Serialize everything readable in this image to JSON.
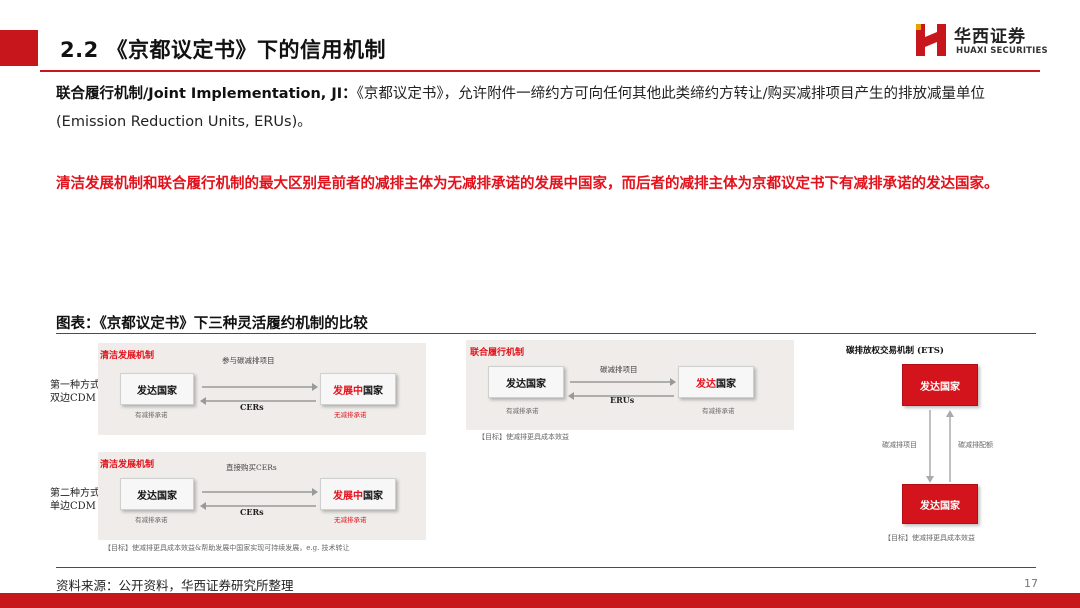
{
  "header": {
    "title": "2.2 《京都议定书》下的信用机制",
    "logo_cn": "华西证券",
    "logo_en": "HUAXI SECURITIES"
  },
  "body": {
    "para1_term": "联合履行机制/Joint Implementation, JI：",
    "para1_text": "《京都议定书》，允许附件一缔约方可向任何其他此类缔约方转让/购买减排项目产生的排放减量单位 (Emission Reduction Units, ERUs)。",
    "para2": "清洁发展机制和联合履行机制的最大区别是前者的减排主体为无减排承诺的发展中国家，而后者的减排主体为京都议定书下有减排承诺的发达国家。"
  },
  "figure": {
    "title": "图表：《京都议定书》下三种灵活履约机制的比较",
    "cdm1": {
      "side_label_1": "第一种方式：",
      "side_label_2": "双边CDM",
      "panel_title": "清洁发展机制",
      "top_arrow_label": "参与碳减排项目",
      "left_box": "发达国家",
      "left_sub": "有减排承诺",
      "right_box_a": "发展",
      "right_box_b": "中",
      "right_box_c": "国家",
      "right_sub": "无减排承诺",
      "bottom_arrow_label": "CERs"
    },
    "cdm2": {
      "side_label_1": "第二种方式：",
      "side_label_2": "单边CDM",
      "panel_title": "清洁发展机制",
      "top_arrow_label": "直接购买CERs",
      "left_box": "发达国家",
      "left_sub": "有减排承诺",
      "right_box_a": "发展",
      "right_box_b": "中",
      "right_box_c": "国家",
      "right_sub": "无减排承诺",
      "bottom_arrow_label": "CERs",
      "goal": "【目标】使减排更具成本效益&帮助发展中国家实现可持续发展，e.g. 技术转让"
    },
    "ji": {
      "panel_title": "联合履行机制",
      "top_arrow_label": "碳减排项目",
      "left_box": "发达国家",
      "left_sub": "有减排承诺",
      "right_box": "发达国家",
      "right_box_a": "发达",
      "right_box_b": "国家",
      "right_sub": "有减排承诺",
      "bottom_arrow_label": "ERUs",
      "goal": "【目标】使减排更具成本效益"
    },
    "ets": {
      "panel_title": "碳排放权交易机制 (ETS)",
      "top_box": "发达国家",
      "bottom_box": "发达国家",
      "left_arrow_label": "碳减排项目",
      "right_arrow_label": "碳减排配额",
      "goal": "【目标】使减排更具成本效益"
    }
  },
  "footer": {
    "source": "资料来源：公开资料，华西证券研究所整理",
    "page_number": "17"
  },
  "colors": {
    "brand_red": "#c8161d",
    "highlight_red": "#e3111b",
    "panel_bg": "#efece9"
  }
}
